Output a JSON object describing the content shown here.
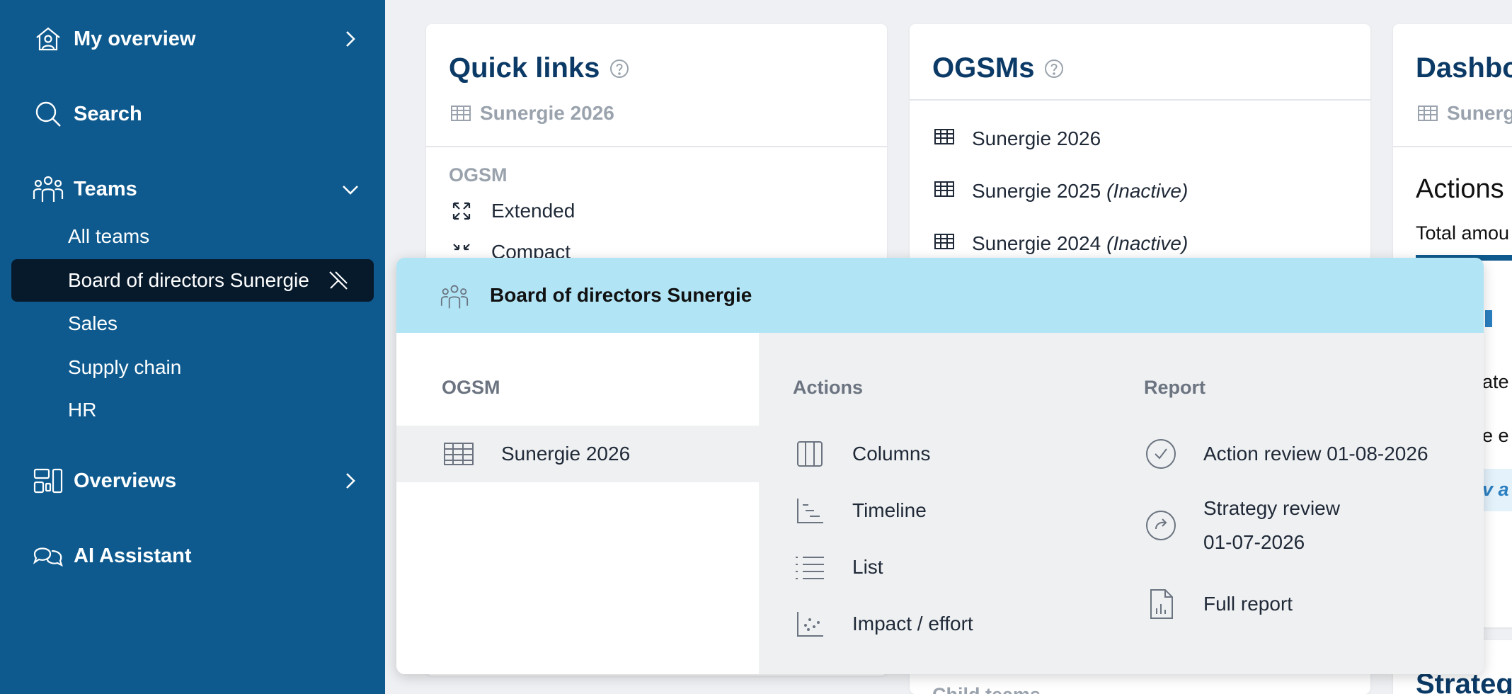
{
  "sidebar": {
    "my_overview": "My overview",
    "search": "Search",
    "teams": "Teams",
    "team_items": [
      "All teams",
      "Board of directors Sunergie",
      "Sales",
      "Supply chain",
      "HR"
    ],
    "overviews": "Overviews",
    "ai_assistant": "AI Assistant"
  },
  "quick_links": {
    "title": "Quick links",
    "subtitle": "Sunergie 2026",
    "section": "OGSM",
    "items": [
      "Extended",
      "Compact"
    ]
  },
  "ogsms": {
    "title": "OGSMs",
    "items": [
      {
        "name": "Sunergie 2026",
        "status": ""
      },
      {
        "name": "Sunergie 2025",
        "status": "(Inactive)"
      },
      {
        "name": "Sunergie 2024",
        "status": "(Inactive)"
      }
    ],
    "bottom_label": "Child teams"
  },
  "dashboard": {
    "title": "Dashbo",
    "subtitle": "Sunerg",
    "actions_title": "Actions",
    "total_text": "Total amou",
    "fragments": [
      "ate",
      "e e",
      "v a"
    ],
    "bottom_title": "Strateg"
  },
  "popup": {
    "title": "Board of directors Sunergie",
    "ogsm_head": "OGSM",
    "ogsm_items": [
      "Sunergie 2026"
    ],
    "actions_head": "Actions",
    "actions_items": [
      "Columns",
      "Timeline",
      "List",
      "Impact / effort"
    ],
    "report_head": "Report",
    "report_items": [
      "Action review 01-08-2026",
      "Strategy review",
      "01-07-2026",
      "Full report"
    ]
  },
  "colors": {
    "sidebar_bg": "#0e5a8e",
    "active_item_bg": "#071a2c",
    "popup_header_bg": "#b1e5f6",
    "title_color": "#0b3a66"
  }
}
